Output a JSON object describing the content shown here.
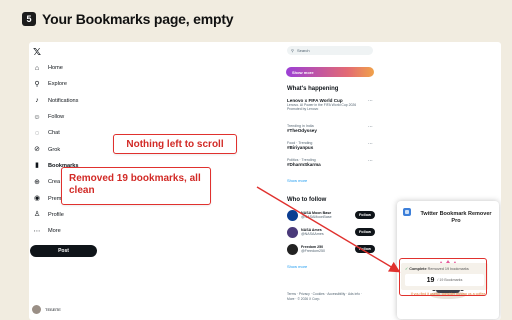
{
  "step": {
    "number": "5",
    "title": "Your Bookmarks page, empty"
  },
  "sidebar": {
    "logo": "𝕏",
    "items": [
      {
        "label": "Home",
        "icon": "home-icon"
      },
      {
        "label": "Explore",
        "icon": "search-icon"
      },
      {
        "label": "Notifications",
        "icon": "bell-icon"
      },
      {
        "label": "Follow",
        "icon": "follow-icon"
      },
      {
        "label": "Chat",
        "icon": "chat-icon"
      },
      {
        "label": "Grok",
        "icon": "grok-icon"
      },
      {
        "label": "Bookmarks",
        "icon": "bookmark-icon",
        "active": true
      },
      {
        "label": "Crea",
        "icon": "create-icon"
      },
      {
        "label": "Prem",
        "icon": "premium-icon"
      },
      {
        "label": "Profile",
        "icon": "profile-icon"
      },
      {
        "label": "More",
        "icon": "more-icon"
      }
    ],
    "post_label": "Post",
    "profile_label": "ТЕБЕПЕ"
  },
  "callouts": {
    "scroll": "Nothing left to scroll",
    "removed": "Removed 19 bookmarks, all clean"
  },
  "right": {
    "search_placeholder": "Search",
    "show_more_button": "Show more",
    "happening_title": "What's happening",
    "trends": [
      {
        "meta": "",
        "name": "Lenovo x FIFA World Cup",
        "promo": "Lenovo. AI Power in the FIFA World Cup 2026",
        "sub": "Promoted by Lenovo"
      },
      {
        "meta": "Trending in India",
        "name": "#TheOdyssey",
        "promo": "",
        "sub": ""
      },
      {
        "meta": "Food · Trending",
        "name": "#Biriyanpus",
        "promo": "",
        "sub": ""
      },
      {
        "meta": "Politics · Trending",
        "name": "#DharmSkarma",
        "promo": "",
        "sub": ""
      }
    ],
    "show_more_1": "Show more",
    "who_to_follow_title": "Who to follow",
    "follows": [
      {
        "name": "NASA Moon Base",
        "handle": "@NASAMoonBase"
      },
      {
        "name": "NASA Ames",
        "handle": "@NASAAmes"
      },
      {
        "name": "Freedom 250",
        "handle": "@Freedom250"
      }
    ],
    "follow_label": "Follow",
    "show_more_2": "Show more",
    "footer": "Terms · Privacy · Cookies · Accessibility · Ads info · More · © 2026 X Corp."
  },
  "extension": {
    "title": "Twitter Bookmark Remover Pro",
    "status_prefix": "Complete",
    "status_text": "Removed 19 bookmarks",
    "count": "19",
    "count_label": "/ 19 Bookmarks",
    "support": "If you find it useful, consider buying us a coffee"
  },
  "colors": {
    "accent_red": "#e0312e",
    "callout_text": "#d22a26",
    "link_blue": "#1d9bf0",
    "page_bg": "#f1ece0"
  }
}
